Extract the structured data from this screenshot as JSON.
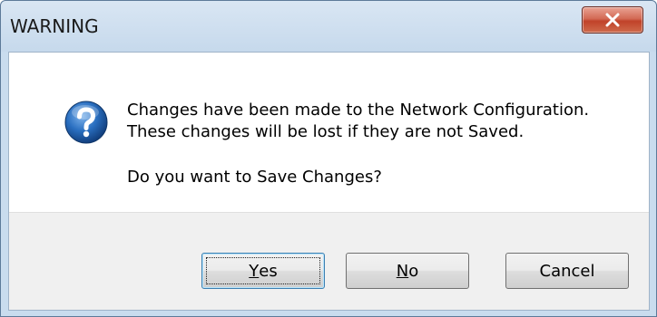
{
  "window": {
    "title": "WARNING",
    "close_icon": "close-x-icon"
  },
  "message": {
    "icon": "question-icon",
    "line1": "Changes have been made to the Network Configuration.",
    "line2": "These changes will be lost if they are not Saved.",
    "line3": "Do you want to Save Changes?"
  },
  "buttons": {
    "yes": {
      "mnemonic": "Y",
      "rest": "es"
    },
    "no": {
      "mnemonic": "N",
      "rest": "o"
    },
    "cancel": {
      "label": "Cancel"
    }
  },
  "colors": {
    "titlebar": "#c9dcee",
    "close_button": "#c94b31",
    "icon_blue": "#1f5fae",
    "button_bar": "#f0f0f0"
  }
}
